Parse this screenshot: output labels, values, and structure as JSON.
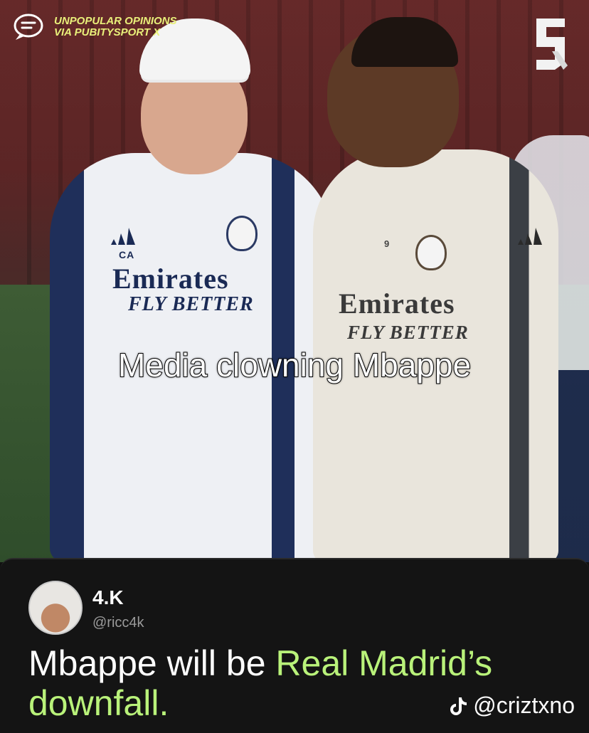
{
  "header": {
    "line1": "UNPOPULAR OPINIONS",
    "line2": "VIA PUBITYSPORT X",
    "accent": "#e9f07a"
  },
  "photo": {
    "kit_sponsor_coach": "Emirates",
    "kit_slogan_coach": "FLY BETTER",
    "kit_initials_coach": "CA",
    "kit_sponsor_player": "Emirates",
    "kit_slogan_player": "FLY BETTER",
    "kit_number_player": "9"
  },
  "caption": "Media clowning Mbappe",
  "tweet": {
    "display_name": "4.K",
    "handle": "@ricc4k",
    "text_plain": "Mbappe will be ",
    "text_highlight": "Real Madrid’s downfall.",
    "highlight_color": "#b9f27a"
  },
  "watermark": {
    "handle": "@criztxno",
    "icon": "tiktok-icon"
  }
}
